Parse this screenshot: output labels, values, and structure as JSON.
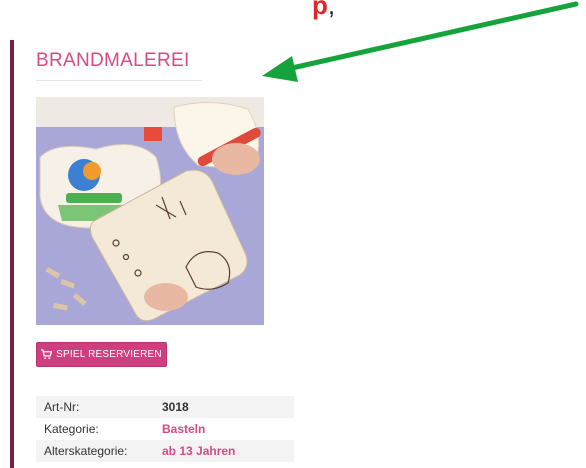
{
  "header_fragment": {
    "accent": "p",
    "rest": ","
  },
  "product": {
    "title": "BRANDMALEREI",
    "image_alt": "Brandmalerei Holzplatten mit Brennkolben",
    "reserve_button": "SPIEL RESERVIEREN"
  },
  "details": [
    {
      "label": "Art-Nr:",
      "value": "3018",
      "is_link": false
    },
    {
      "label": "Kategorie:",
      "value": "Basteln",
      "is_link": true
    },
    {
      "label": "Alterskategorie:",
      "value": "ab 13 Jahren",
      "is_link": true
    }
  ],
  "colors": {
    "accent_bar": "#7a1e48",
    "title": "#d44b87",
    "button": "#cf3f7f",
    "arrow": "#17a33b",
    "header_red": "#e0262a"
  },
  "icons": {
    "button_icon": "cart-icon",
    "annotation": "arrow-icon"
  }
}
